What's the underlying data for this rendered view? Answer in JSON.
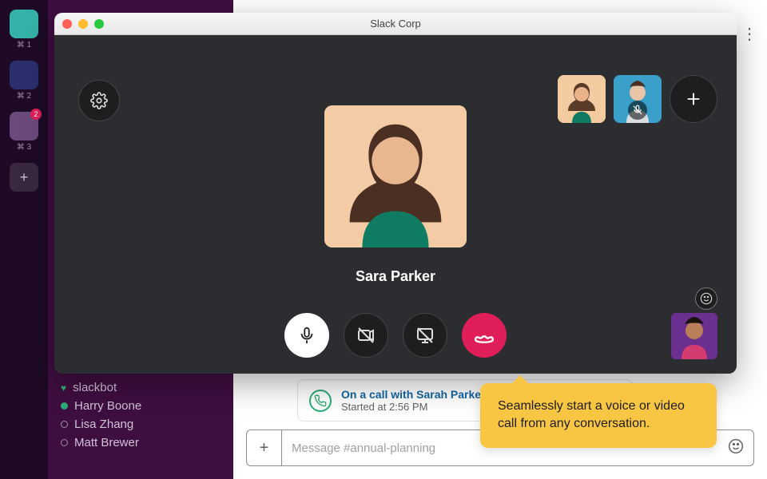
{
  "workspaces": {
    "items": [
      {
        "label": "⌘ 1",
        "badge": ""
      },
      {
        "label": "⌘ 2",
        "badge": ""
      },
      {
        "label": "⌘ 3",
        "badge": "2"
      }
    ]
  },
  "sidebar": {
    "dms": [
      {
        "name": "slackbot",
        "presence": "heart"
      },
      {
        "name": "Harry Boone",
        "presence": "active"
      },
      {
        "name": "Lisa Zhang",
        "presence": "away"
      },
      {
        "name": "Matt Brewer",
        "presence": "away"
      }
    ]
  },
  "call_notice": {
    "title": "On a call with Sarah Parker",
    "subtitle": "Started at 2:56 PM"
  },
  "composer": {
    "placeholder": "Message #annual-planning"
  },
  "call": {
    "window_title": "Slack Corp",
    "caller_name": "Sara Parker"
  },
  "tooltip": {
    "text": "Seamlessly start a voice or video call from any conversation."
  }
}
